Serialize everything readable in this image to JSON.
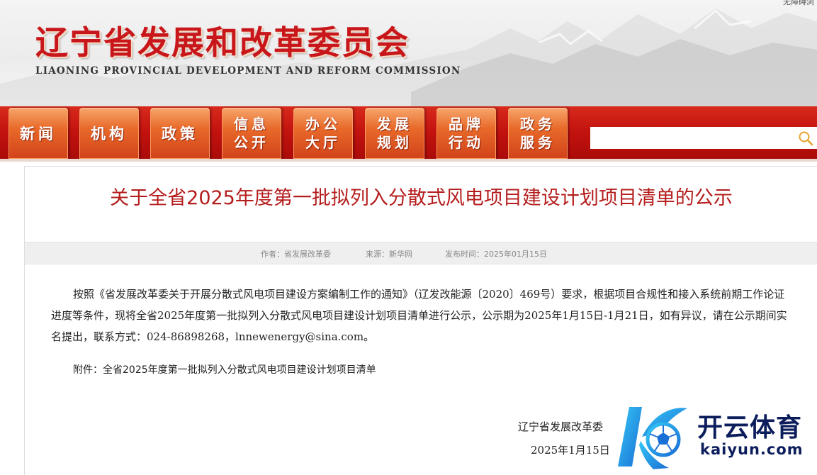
{
  "header": {
    "title": "辽宁省发展和改革委员会",
    "subtitle": "LIAONING PROVINCIAL DEVELOPMENT AND REFORM COMMISSION",
    "accessibility_link": "无障碍浏"
  },
  "nav": {
    "items": [
      {
        "label": "新闻"
      },
      {
        "label": "机构"
      },
      {
        "label": "政策"
      },
      {
        "label": "信息\n公开"
      },
      {
        "label": "办公\n大厅"
      },
      {
        "label": "发展\n规划"
      },
      {
        "label": "品牌\n行动"
      },
      {
        "label": "政务\n服务"
      }
    ],
    "search": {
      "value": "",
      "icon": "search-icon"
    }
  },
  "article": {
    "title": "关于全省2025年度第一批拟列入分散式风电项目建设计划项目清单的公示",
    "meta": {
      "author": "作者：省发展改革委",
      "source": "来源：新华网",
      "published": "发布时间：2025年01月15日"
    },
    "body": "按照《省发展改革委关于开展分散式风电项目建设方案编制工作的通知》（辽发改能源〔2020〕469号）要求，根据项目合规性和接入系统前期工作论证进度等条件，现将全省2025年度第一批拟列入分散式风电项目建设计划项目清单进行公示，公示期为2025年1月15日-1月21日，如有异议，请在公示期间实名提出，联系方式：024-86898268，lnnewenergy@sina.com。",
    "attachment_prefix": "附件：",
    "attachment_link": "全省2025年度第一批拟列入分散式风电项目建设计划项目清单",
    "signature_org": "辽宁省发展改革委",
    "signature_date": "2025年1月15日"
  },
  "watermark": {
    "brand": "开云体育",
    "domain": "kaiyun.com"
  },
  "colors": {
    "brand_red": "#c8161b",
    "title_red": "#b51d1d",
    "nav_orange": "#e86a2a",
    "watermark_navy": "#0c1d5c"
  }
}
